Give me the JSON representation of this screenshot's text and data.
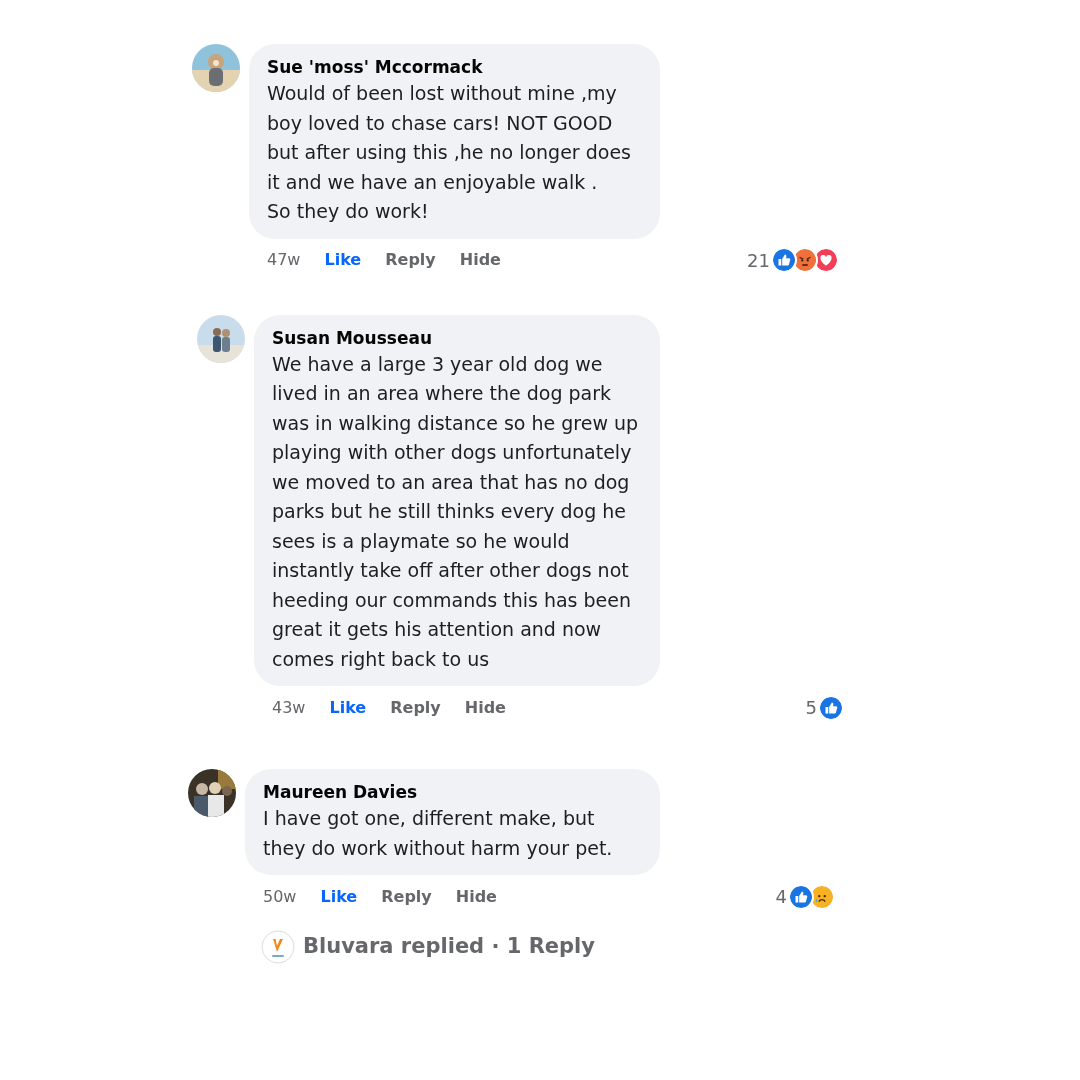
{
  "comments": [
    {
      "author": "Sue 'moss' Mccormack",
      "text": "Would of been lost without mine ,my boy loved to chase cars! NOT GOOD but after using this ,he no longer does it and we have an enjoyable walk .\nSo they do work!",
      "time": "47w",
      "actions": [
        {
          "label": "Like",
          "selected": true
        },
        {
          "label": "Reply",
          "selected": false
        },
        {
          "label": "Hide",
          "selected": false
        }
      ],
      "reaction_count": "21",
      "reactions": [
        {
          "kind": "like"
        },
        {
          "kind": "angry"
        },
        {
          "kind": "love"
        }
      ]
    },
    {
      "author": "Susan Mousseau",
      "text": "We have a large 3 year old dog we lived in an area where the dog park was in walking distance so he grew up playing with other dogs unfortunately we moved to an area that has no dog parks but he still thinks every dog he sees is a playmate so he would instantly take off after other dogs not heeding our commands this has been great it gets his attention and now comes right back to us",
      "time": "43w",
      "actions": [
        {
          "label": "Like",
          "selected": true
        },
        {
          "label": "Reply",
          "selected": false
        },
        {
          "label": "Hide",
          "selected": false
        }
      ],
      "reaction_count": "5",
      "reactions": [
        {
          "kind": "like"
        }
      ]
    },
    {
      "author": "Maureen Davies",
      "text": "I have got one, different make, but they do work without harm your pet.",
      "time": "50w",
      "actions": [
        {
          "label": "Like",
          "selected": true
        },
        {
          "label": "Reply",
          "selected": false
        },
        {
          "label": "Hide",
          "selected": false
        }
      ],
      "reaction_count": "4",
      "reactions": [
        {
          "kind": "like"
        },
        {
          "kind": "sad"
        }
      ],
      "replies_link": "Bluvara replied · 1 Reply"
    }
  ]
}
